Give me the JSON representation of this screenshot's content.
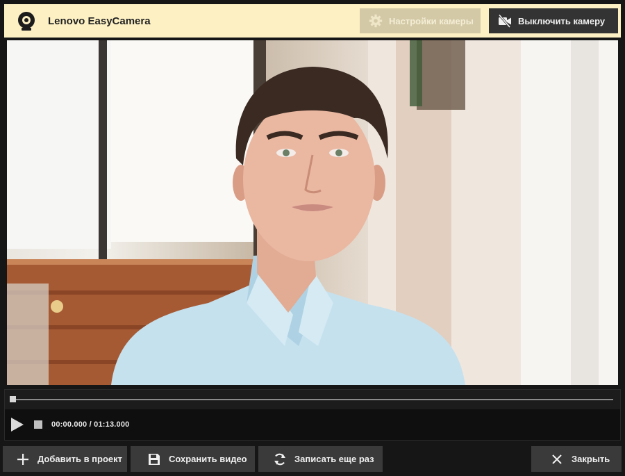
{
  "header": {
    "logo_icon": "webcam-icon",
    "title": "Lenovo EasyCamera",
    "settings_button": {
      "label": "Настройки камеры",
      "icon": "gear-icon",
      "enabled": false
    },
    "camera_off_button": {
      "label": "Выключить камеру",
      "icon": "camera-off-icon"
    }
  },
  "video": {
    "content": "webcam preview"
  },
  "player": {
    "progress": 0,
    "current_time": "00:00.000",
    "separator": "/",
    "total_time": "01:13.000",
    "play_icon": "play-icon",
    "stop_icon": "stop-icon"
  },
  "footer": {
    "add_to_project": {
      "label": "Добавить в проект",
      "icon": "plus-icon"
    },
    "save_video": {
      "label": "Сохранить видео",
      "icon": "save-icon"
    },
    "record_again": {
      "label": "Записать еще раз",
      "icon": "refresh-icon"
    },
    "close": {
      "label": "Закрыть",
      "icon": "close-icon"
    }
  },
  "colors": {
    "header_bg": "#fdf1c4",
    "button_dark": "#3a3a3a",
    "button_disabled": "#d3c9a6",
    "background": "#161616"
  }
}
